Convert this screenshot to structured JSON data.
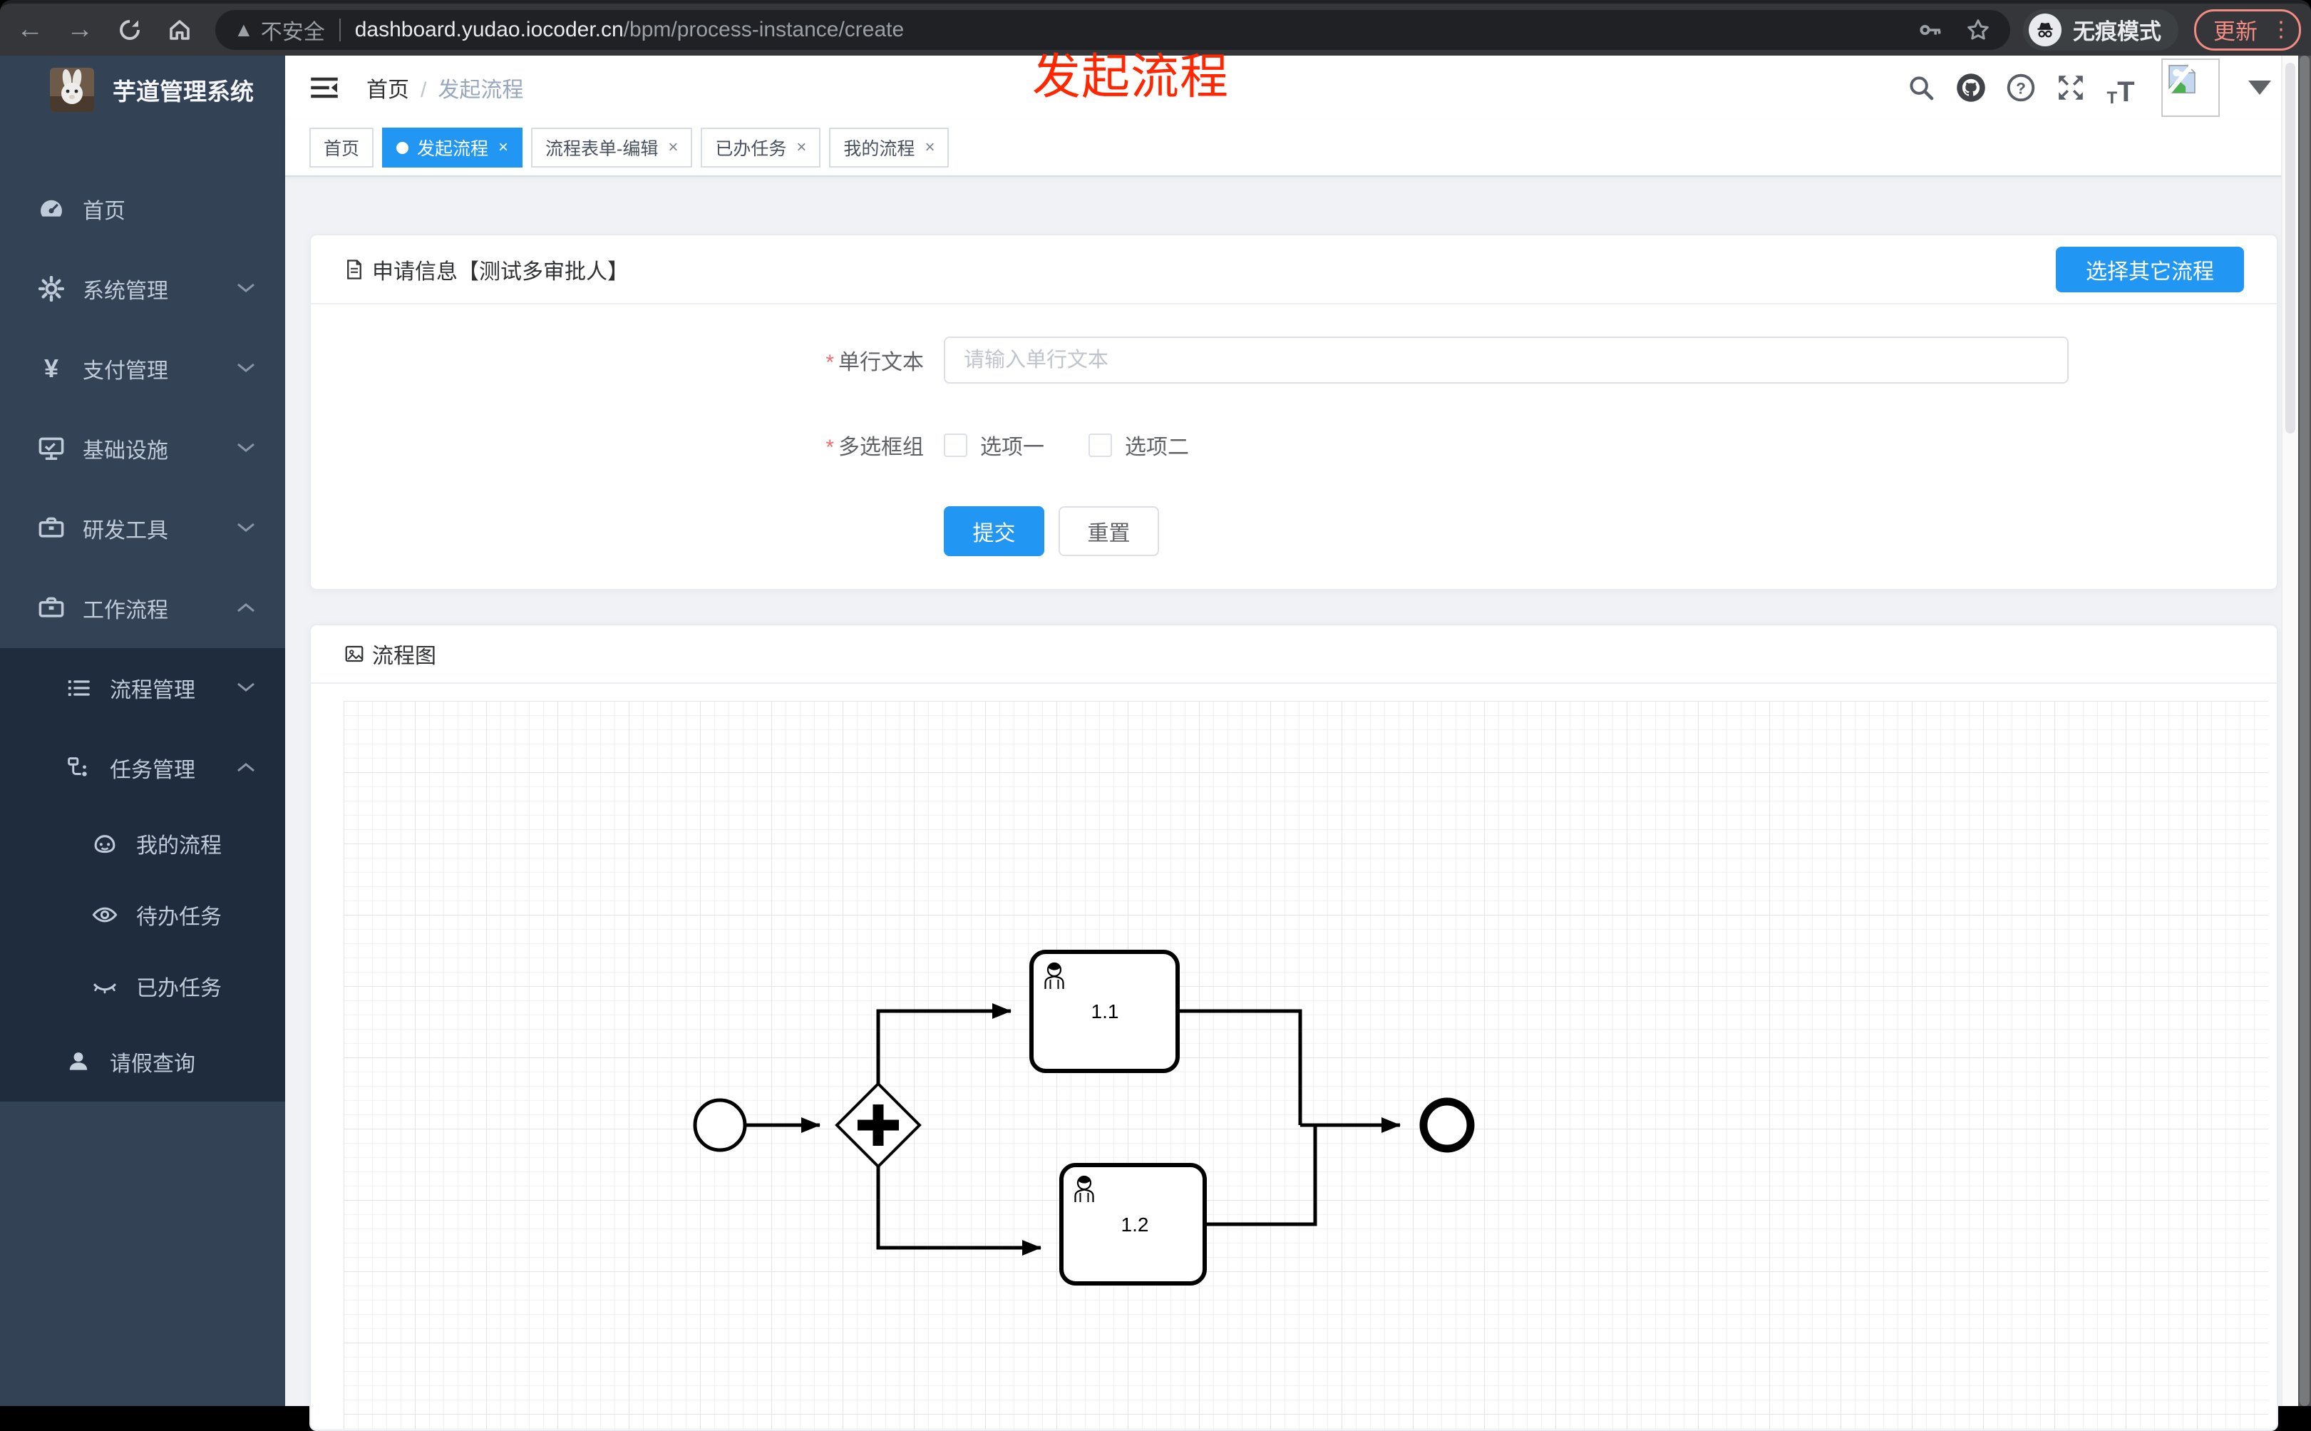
{
  "browser": {
    "security_label": "不安全",
    "url_host": "dashboard.yudao.iocoder.cn",
    "url_path": "/bpm/process-instance/create",
    "incognito_label": "无痕模式",
    "update_label": "更新",
    "update_accent_color": "#f28b82",
    "toolbar_color": "#35363a"
  },
  "overlay": {
    "text": "发起流程",
    "color": "#ff2600"
  },
  "sidebar": {
    "title": "芋道管理系统",
    "bg_color": "#344256",
    "submenu_bg_color": "#1f2c3d",
    "text_color": "#bfcbd9",
    "items": [
      {
        "label": "首页",
        "icon": "dashboard-icon",
        "level": 1
      },
      {
        "label": "系统管理",
        "icon": "gear-icon",
        "level": 1,
        "chevron": "down"
      },
      {
        "label": "支付管理",
        "icon": "yen-icon",
        "level": 1,
        "chevron": "down"
      },
      {
        "label": "基础设施",
        "icon": "monitor-icon",
        "level": 1,
        "chevron": "down"
      },
      {
        "label": "研发工具",
        "icon": "toolbox-icon",
        "level": 1,
        "chevron": "down"
      },
      {
        "label": "工作流程",
        "icon": "toolbox-icon",
        "level": 1,
        "chevron": "up",
        "expanded": true
      },
      {
        "label": "流程管理",
        "icon": "list-icon",
        "level": 2,
        "chevron": "down"
      },
      {
        "label": "任务管理",
        "icon": "flow-icon",
        "level": 2,
        "chevron": "up",
        "expanded": true
      },
      {
        "label": "我的流程",
        "icon": "face-icon",
        "level": 3
      },
      {
        "label": "待办任务",
        "icon": "eye-icon",
        "level": 3
      },
      {
        "label": "已办任务",
        "icon": "eye-closed-icon",
        "level": 3
      },
      {
        "label": "请假查询",
        "icon": "user-icon",
        "level": 2
      }
    ]
  },
  "header": {
    "breadcrumb_home": "首页",
    "breadcrumb_current": "发起流程",
    "right_icons": [
      "search-icon",
      "github-icon",
      "help-icon",
      "fullscreen-icon",
      "font-size-icon",
      "avatar",
      "caret-down-icon"
    ]
  },
  "tabs": [
    {
      "label": "首页",
      "active": false,
      "closable": false
    },
    {
      "label": "发起流程",
      "active": true,
      "closable": true
    },
    {
      "label": "流程表单-编辑",
      "active": false,
      "closable": true
    },
    {
      "label": "已办任务",
      "active": false,
      "closable": true
    },
    {
      "label": "我的流程",
      "active": false,
      "closable": true
    }
  ],
  "form_card": {
    "title": "申请信息【测试多审批人】",
    "action_label": "选择其它流程",
    "fields": [
      {
        "label": "单行文本",
        "required": true,
        "type": "text",
        "value": "",
        "placeholder": "请输入单行文本"
      },
      {
        "label": "多选框组",
        "required": true,
        "type": "checkbox-group",
        "options": [
          "选项一",
          "选项二"
        ],
        "checked": [
          false,
          false
        ]
      }
    ],
    "submit_label": "提交",
    "reset_label": "重置",
    "accent_color": "#2196f3",
    "required_color": "#f56c6c"
  },
  "diagram_card": {
    "title": "流程图",
    "type": "bpmn",
    "nodes": [
      {
        "id": "start",
        "kind": "start-event"
      },
      {
        "id": "gateway",
        "kind": "parallel-gateway"
      },
      {
        "id": "task1",
        "kind": "user-task",
        "label": "1.1"
      },
      {
        "id": "task2",
        "kind": "user-task",
        "label": "1.2"
      },
      {
        "id": "end",
        "kind": "end-event"
      }
    ],
    "edges": [
      {
        "from": "start",
        "to": "gateway"
      },
      {
        "from": "gateway",
        "to": "task1"
      },
      {
        "from": "gateway",
        "to": "task2"
      },
      {
        "from": "task1",
        "to": "end"
      },
      {
        "from": "task2",
        "to": "end"
      }
    ],
    "tasks": [
      {
        "label": "1.1"
      },
      {
        "label": "1.2"
      }
    ]
  }
}
